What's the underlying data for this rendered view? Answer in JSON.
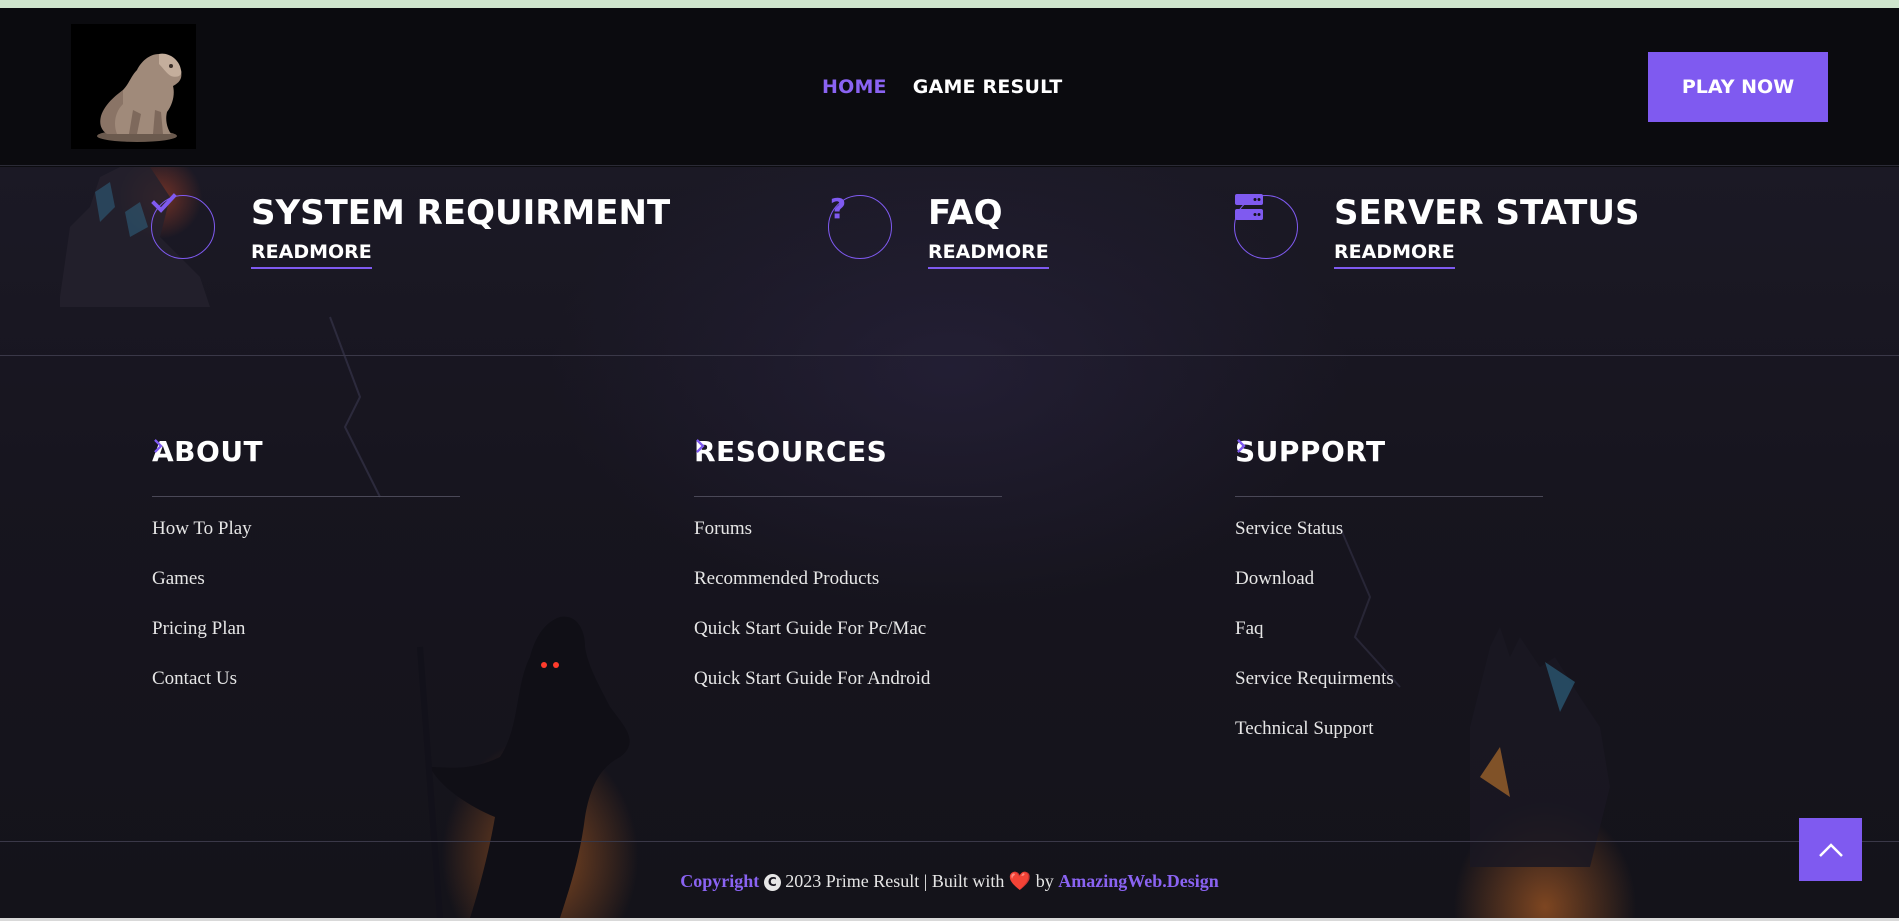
{
  "header": {
    "logo_alt": "Lion statue logo",
    "nav": [
      {
        "label": "HOME",
        "active": true
      },
      {
        "label": "GAME RESULT",
        "active": false
      }
    ],
    "play_button": "PLAY NOW"
  },
  "features": [
    {
      "icon": "check-icon",
      "title": "SYSTEM REQUIRMENT",
      "link": "READMORE"
    },
    {
      "icon": "question-icon",
      "title": "FAQ",
      "link": "READMORE"
    },
    {
      "icon": "server-icon",
      "title": "SERVER STATUS",
      "link": "READMORE"
    }
  ],
  "footer": {
    "columns": [
      {
        "title": "ABOUT",
        "links": [
          "How To Play",
          "Games",
          "Pricing Plan",
          "Contact Us"
        ]
      },
      {
        "title": "RESOURCES",
        "links": [
          "Forums",
          "Recommended Products",
          "Quick Start Guide For Pc/Mac",
          "Quick Start Guide For Android"
        ]
      },
      {
        "title": "SUPPORT",
        "links": [
          "Service Status",
          "Download",
          "Faq",
          "Service Requirments",
          "Technical Support"
        ]
      }
    ],
    "copyright": {
      "label": "Copyright",
      "symbol": "C",
      "text": " 2023 Prime Result | Built with ",
      "heart": "❤️",
      "by": " by ",
      "brand": "AmazingWeb.Design"
    }
  },
  "colors": {
    "accent": "#7f5af0",
    "background": "#0c0c10"
  },
  "scroll_top_icon": "chevron-up-icon"
}
